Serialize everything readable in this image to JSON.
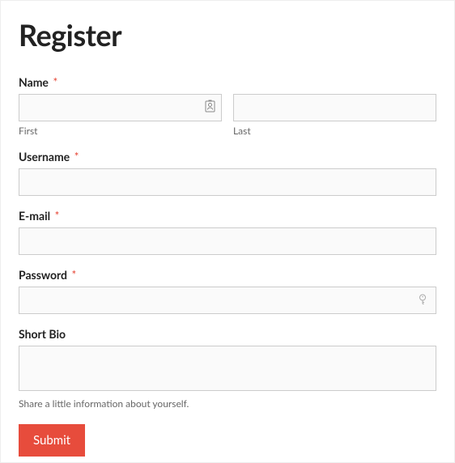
{
  "heading": "Register",
  "name": {
    "label": "Name",
    "required": "*",
    "first_sublabel": "First",
    "last_sublabel": "Last",
    "first_value": "",
    "last_value": ""
  },
  "username": {
    "label": "Username",
    "required": "*",
    "value": ""
  },
  "email": {
    "label": "E-mail",
    "required": "*",
    "value": ""
  },
  "password": {
    "label": "Password",
    "required": "*",
    "value": ""
  },
  "bio": {
    "label": "Short Bio",
    "value": "",
    "hint": "Share a little information about yourself."
  },
  "submit": {
    "label": "Submit"
  },
  "colors": {
    "accent": "#e74c3c"
  }
}
